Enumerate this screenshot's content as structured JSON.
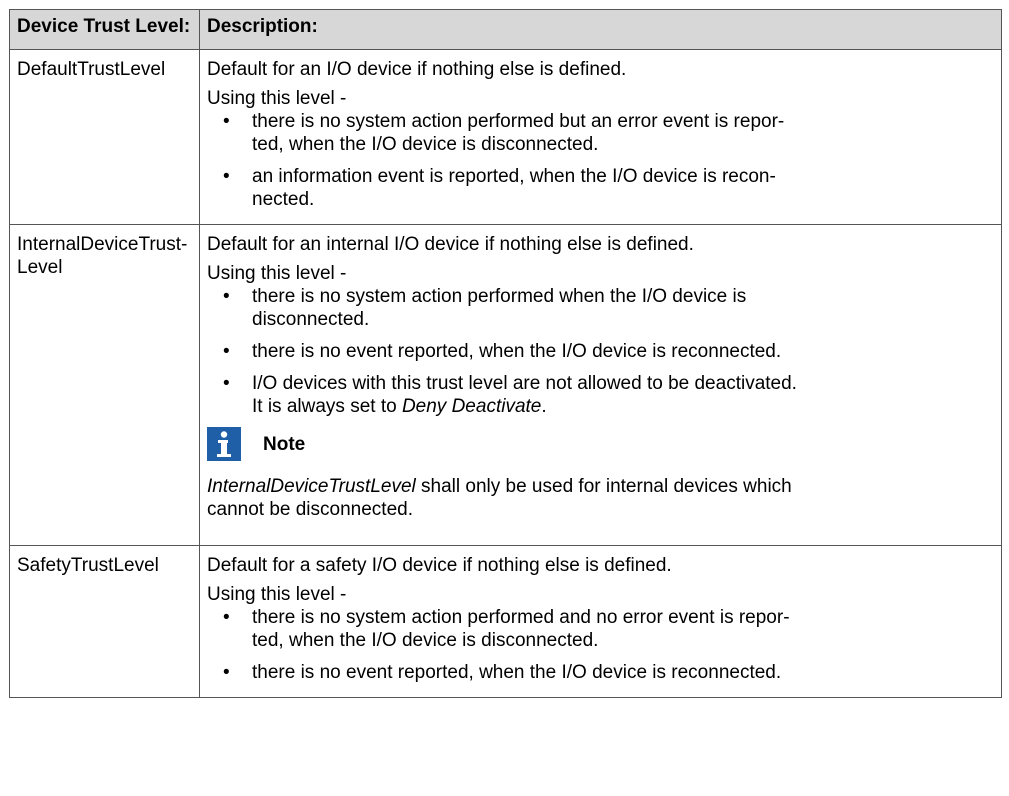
{
  "table": {
    "headers": [
      "Device Trust Level:",
      "Description:"
    ],
    "rows": [
      {
        "level": "DefaultTrustLevel",
        "intro": "Default for an I/O device if nothing else is defined.",
        "lead": "Using this level -",
        "bullets": [
          "there is no system action performed but an error event is repor-ted, when the I/O device is disconnected.",
          "an information event is reported, when the I/O device is recon-nected."
        ]
      },
      {
        "level": "InternalDeviceTrust-Level",
        "intro": "Default for an internal I/O device if nothing else is defined.",
        "lead": "Using this level -",
        "bullets": [
          "there is no system action performed when the I/O device is disconnected.",
          "there is no event reported, when the I/O device is reconnected.",
          "I/O devices with this trust level are not allowed to be deactivated. It is always set to"
        ],
        "bullet3_em": "Deny Deactivate",
        "bullet3_tail": ".",
        "note_title": "Note",
        "note_em": "InternalDeviceTrustLevel",
        "note_text": " shall only be used for internal devices which cannot be disconnected."
      },
      {
        "level": "SafetyTrustLevel",
        "intro": "Default for a safety I/O device if nothing else is defined.",
        "lead": "Using this level -",
        "bullets": [
          "there is no system action performed and no error event is repor-ted, when the I/O device is disconnected.",
          "there is no event reported, when the I/O device is reconnected."
        ]
      }
    ]
  }
}
